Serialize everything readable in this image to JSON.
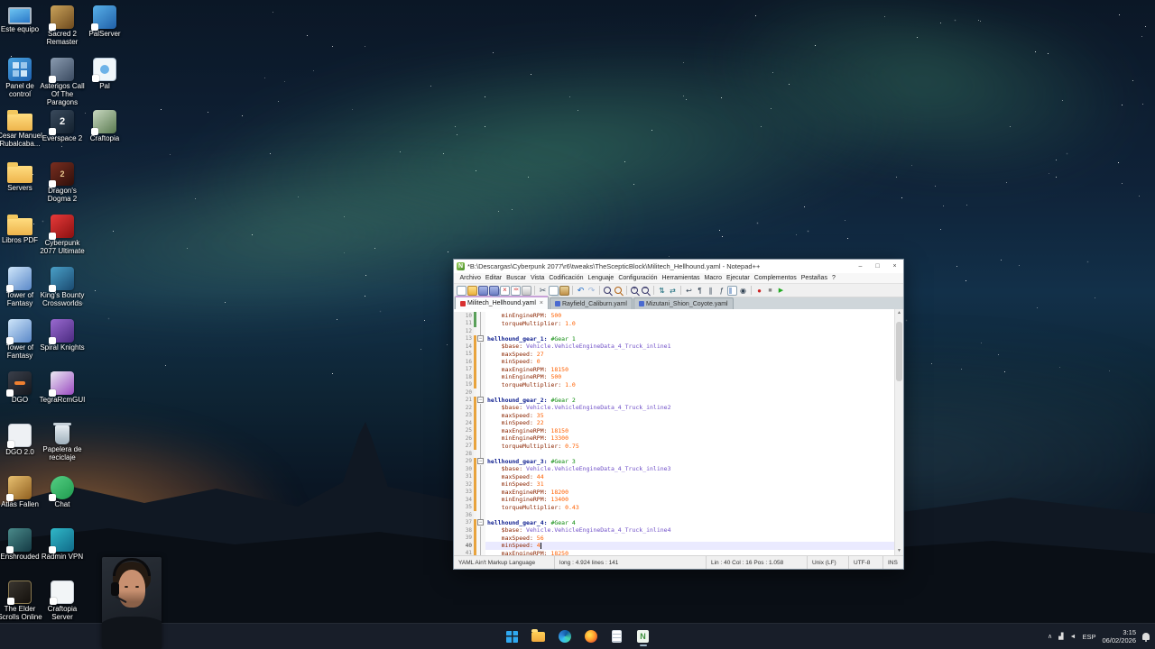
{
  "theme": {
    "c_key": "#8b2500",
    "c_num": "#ff6000",
    "c_comment": "#0a8a0a",
    "c_value": "#7050c8",
    "c_top": "#102090",
    "current_line": "#eaeaff",
    "mark_orange": "#e8a33d",
    "mark_green": "#5aa05a"
  },
  "desktop": {
    "columns": [
      {
        "items": [
          {
            "label": "Este equipo",
            "icon": "this-pc",
            "shortcut": false
          },
          {
            "label": "Panel de control",
            "icon": "control-panel",
            "shortcut": false
          },
          {
            "label": "Cesar Manuel Rubalcaba...",
            "icon": "folder",
            "shortcut": false
          },
          {
            "label": "Servers",
            "icon": "folder",
            "shortcut": false
          },
          {
            "label": "Libros PDF",
            "icon": "folder",
            "shortcut": false
          },
          {
            "label": "Tower of Fantasy",
            "icon": "tower-of-fantasy",
            "shortcut": true
          },
          {
            "label": "Tower of Fantasy",
            "icon": "tower-of-fantasy",
            "shortcut": true
          },
          {
            "label": "DGO",
            "icon": "dgo",
            "shortcut": true
          },
          {
            "label": "DGO 2.0",
            "icon": "dgo2",
            "shortcut": true
          },
          {
            "label": "Atlas Fallen",
            "icon": "atlas-fallen",
            "shortcut": true
          },
          {
            "label": "Enshrouded",
            "icon": "enshrouded",
            "shortcut": true
          },
          {
            "label": "The Elder Scrolls Online",
            "icon": "eso",
            "shortcut": true
          }
        ]
      },
      {
        "items": [
          {
            "label": "Sacred 2 Remaster",
            "icon": "sacred2",
            "shortcut": true
          },
          {
            "label": "Asterigos Call Of The Paragons",
            "icon": "asterigos",
            "shortcut": true
          },
          {
            "label": "Everspace 2",
            "icon": "everspace2",
            "shortcut": true
          },
          {
            "label": "Dragon's Dogma 2",
            "icon": "dragons-dogma2",
            "shortcut": true
          },
          {
            "label": "Cyberpunk 2077 Ultimate",
            "icon": "cyberpunk",
            "shortcut": true
          },
          {
            "label": "King's Bounty Crossworlds",
            "icon": "kings-bounty",
            "shortcut": true
          },
          {
            "label": "Spiral Knights",
            "icon": "spiral-knights",
            "shortcut": true
          },
          {
            "label": "TegraRcmGUI",
            "icon": "tegra",
            "shortcut": true
          },
          {
            "label": "Papelera de reciclaje",
            "icon": "recycle-bin",
            "shortcut": false
          },
          {
            "label": "Chat",
            "icon": "chat",
            "shortcut": true
          },
          {
            "label": "Radmin VPN",
            "icon": "radmin",
            "shortcut": true
          },
          {
            "label": "Craftopia Server",
            "icon": "craftopia-server",
            "shortcut": true
          }
        ]
      },
      {
        "items": [
          {
            "label": "PalServer",
            "icon": "palserver",
            "shortcut": true
          },
          {
            "label": "Pal",
            "icon": "pal",
            "shortcut": true
          },
          {
            "label": "Craftopia",
            "icon": "craftopia",
            "shortcut": true
          }
        ]
      }
    ]
  },
  "notepad": {
    "title": "*B:\\Descargas\\Cyberpunk 2077\\r6\\tweaks\\TheScepticBlock\\Militech_Hellhound.yaml - Notepad++",
    "menu": [
      "Archivo",
      "Editar",
      "Buscar",
      "Vista",
      "Codificación",
      "Lenguaje",
      "Configuración",
      "Herramientas",
      "Macro",
      "Ejecutar",
      "Complementos",
      "Pestañas",
      "?"
    ],
    "window_controls": [
      "minimize",
      "maximize",
      "close"
    ],
    "toolbar": [
      "new-file",
      "open-file",
      "save",
      "save-all",
      "close",
      "close-all",
      "print",
      "separator",
      "cut",
      "copy",
      "paste",
      "separator",
      "undo",
      "redo",
      "separator",
      "find",
      "replace",
      "separator",
      "zoom-in",
      "zoom-out",
      "separator",
      "sync-vertical",
      "sync-horizontal",
      "separator",
      "word-wrap",
      "show-all-chars",
      "indent-guide",
      "function-list",
      "document-map",
      "document-monitor",
      "separator",
      "macro-record",
      "macro-stop",
      "macro-play"
    ],
    "tabs": [
      {
        "label": "Militech_Hellhound.yaml",
        "state": "modified",
        "active": true
      },
      {
        "label": "Rayfield_Caliburn.yaml",
        "state": "saved",
        "active": false
      },
      {
        "label": "Mizutani_Shion_Coyote.yaml",
        "state": "saved",
        "active": false
      }
    ],
    "code": {
      "lines": [
        {
          "n": 10,
          "t": [
            [
              "k",
              "    minEngineRPM:"
            ],
            [
              "n",
              " 500"
            ]
          ],
          "m": "g",
          "f": "l"
        },
        {
          "n": 11,
          "t": [
            [
              "k",
              "    torqueMultiplier:"
            ],
            [
              "n",
              " 1.0"
            ]
          ],
          "m": "g",
          "f": "l"
        },
        {
          "n": 12,
          "t": [],
          "m": null,
          "f": "l"
        },
        {
          "n": 13,
          "t": [
            [
              "t",
              "hellhound_gear_1:"
            ],
            [
              "c",
              " #Gear 1"
            ]
          ],
          "m": "m",
          "f": "b"
        },
        {
          "n": 14,
          "t": [
            [
              "k",
              "    $base:"
            ],
            [
              "v",
              " Vehicle.VehicleEngineData_4_Truck_inline1"
            ]
          ],
          "m": "m",
          "f": "l"
        },
        {
          "n": 15,
          "t": [
            [
              "k",
              "    maxSpeed:"
            ],
            [
              "n",
              " 27"
            ]
          ],
          "m": "m",
          "f": "l"
        },
        {
          "n": 16,
          "t": [
            [
              "k",
              "    minSpeed:"
            ],
            [
              "n",
              " 0"
            ]
          ],
          "m": "m",
          "f": "l"
        },
        {
          "n": 17,
          "t": [
            [
              "k",
              "    maxEngineRPM:"
            ],
            [
              "n",
              " 18150"
            ]
          ],
          "m": "m",
          "f": "l"
        },
        {
          "n": 18,
          "t": [
            [
              "k",
              "    minEngineRPM:"
            ],
            [
              "n",
              " 500"
            ]
          ],
          "m": "m",
          "f": "l"
        },
        {
          "n": 19,
          "t": [
            [
              "k",
              "    torqueMultiplier:"
            ],
            [
              "n",
              " 1.0"
            ]
          ],
          "m": "m",
          "f": "l"
        },
        {
          "n": 20,
          "t": [],
          "m": null,
          "f": "l"
        },
        {
          "n": 21,
          "t": [
            [
              "t",
              "hellhound_gear_2:"
            ],
            [
              "c",
              " #Gear 2"
            ]
          ],
          "m": "m",
          "f": "b"
        },
        {
          "n": 22,
          "t": [
            [
              "k",
              "    $base:"
            ],
            [
              "v",
              " Vehicle.VehicleEngineData_4_Truck_inline2"
            ]
          ],
          "m": "m",
          "f": "l"
        },
        {
          "n": 23,
          "t": [
            [
              "k",
              "    maxSpeed:"
            ],
            [
              "n",
              " 35"
            ]
          ],
          "m": "m",
          "f": "l"
        },
        {
          "n": 24,
          "t": [
            [
              "k",
              "    minSpeed:"
            ],
            [
              "n",
              " 22"
            ]
          ],
          "m": "m",
          "f": "l"
        },
        {
          "n": 25,
          "t": [
            [
              "k",
              "    maxEngineRPM:"
            ],
            [
              "n",
              " 18150"
            ]
          ],
          "m": "m",
          "f": "l"
        },
        {
          "n": 26,
          "t": [
            [
              "k",
              "    minEngineRPM:"
            ],
            [
              "n",
              " 13300"
            ]
          ],
          "m": "m",
          "f": "l"
        },
        {
          "n": 27,
          "t": [
            [
              "k",
              "    torqueMultiplier:"
            ],
            [
              "n",
              " 0.75"
            ]
          ],
          "m": "m",
          "f": "l"
        },
        {
          "n": 28,
          "t": [],
          "m": null,
          "f": "l"
        },
        {
          "n": 29,
          "t": [
            [
              "t",
              "hellhound_gear_3:"
            ],
            [
              "c",
              " #Gear 3"
            ]
          ],
          "m": "m",
          "f": "b"
        },
        {
          "n": 30,
          "t": [
            [
              "k",
              "    $base:"
            ],
            [
              "v",
              " Vehicle.VehicleEngineData_4_Truck_inline3"
            ]
          ],
          "m": "m",
          "f": "l"
        },
        {
          "n": 31,
          "t": [
            [
              "k",
              "    maxSpeed:"
            ],
            [
              "n",
              " 44"
            ]
          ],
          "m": "m",
          "f": "l"
        },
        {
          "n": 32,
          "t": [
            [
              "k",
              "    minSpeed:"
            ],
            [
              "n",
              " 31"
            ]
          ],
          "m": "m",
          "f": "l"
        },
        {
          "n": 33,
          "t": [
            [
              "k",
              "    maxEngineRPM:"
            ],
            [
              "n",
              " 18200"
            ]
          ],
          "m": "m",
          "f": "l"
        },
        {
          "n": 34,
          "t": [
            [
              "k",
              "    minEngineRPM:"
            ],
            [
              "n",
              " 13400"
            ]
          ],
          "m": "m",
          "f": "l"
        },
        {
          "n": 35,
          "t": [
            [
              "k",
              "    torqueMultiplier:"
            ],
            [
              "n",
              " 0.43"
            ]
          ],
          "m": "m",
          "f": "l"
        },
        {
          "n": 36,
          "t": [],
          "m": null,
          "f": "l"
        },
        {
          "n": 37,
          "t": [
            [
              "t",
              "hellhound_gear_4:"
            ],
            [
              "c",
              " #Gear 4"
            ]
          ],
          "m": "m",
          "f": "b"
        },
        {
          "n": 38,
          "t": [
            [
              "k",
              "    $base:"
            ],
            [
              "v",
              " Vehicle.VehicleEngineData_4_Truck_inline4"
            ]
          ],
          "m": "m",
          "f": "l"
        },
        {
          "n": 39,
          "t": [
            [
              "k",
              "    maxSpeed:"
            ],
            [
              "n",
              " 56"
            ]
          ],
          "m": "m",
          "f": "l"
        },
        {
          "n": 40,
          "t": [
            [
              "k",
              "    minSpeed:"
            ],
            [
              "n",
              " 4"
            ]
          ],
          "m": "m",
          "f": "l",
          "cur": true
        },
        {
          "n": 41,
          "t": [
            [
              "k",
              "    maxEngineRPM:"
            ],
            [
              "n",
              " 18250"
            ]
          ],
          "m": "m",
          "f": "l"
        }
      ]
    },
    "status": {
      "doc_type": "YAML Ain't Markup Language",
      "length": "long : 4.924    lines : 141",
      "position": "Lin : 40   Col : 16   Pos : 1.058",
      "eol": "Unix (LF)",
      "encoding": "UTF-8",
      "mode": "INS"
    }
  },
  "taskbar": {
    "apps": [
      {
        "name": "start",
        "active": false
      },
      {
        "name": "file-explorer",
        "active": false
      },
      {
        "name": "edge",
        "active": false
      },
      {
        "name": "firefox",
        "active": false
      },
      {
        "name": "notepad",
        "active": false
      },
      {
        "name": "notepad-plus-plus",
        "active": true
      }
    ],
    "tray": {
      "language": "ESP",
      "time": "3:15",
      "date": "06/02/2026"
    }
  }
}
